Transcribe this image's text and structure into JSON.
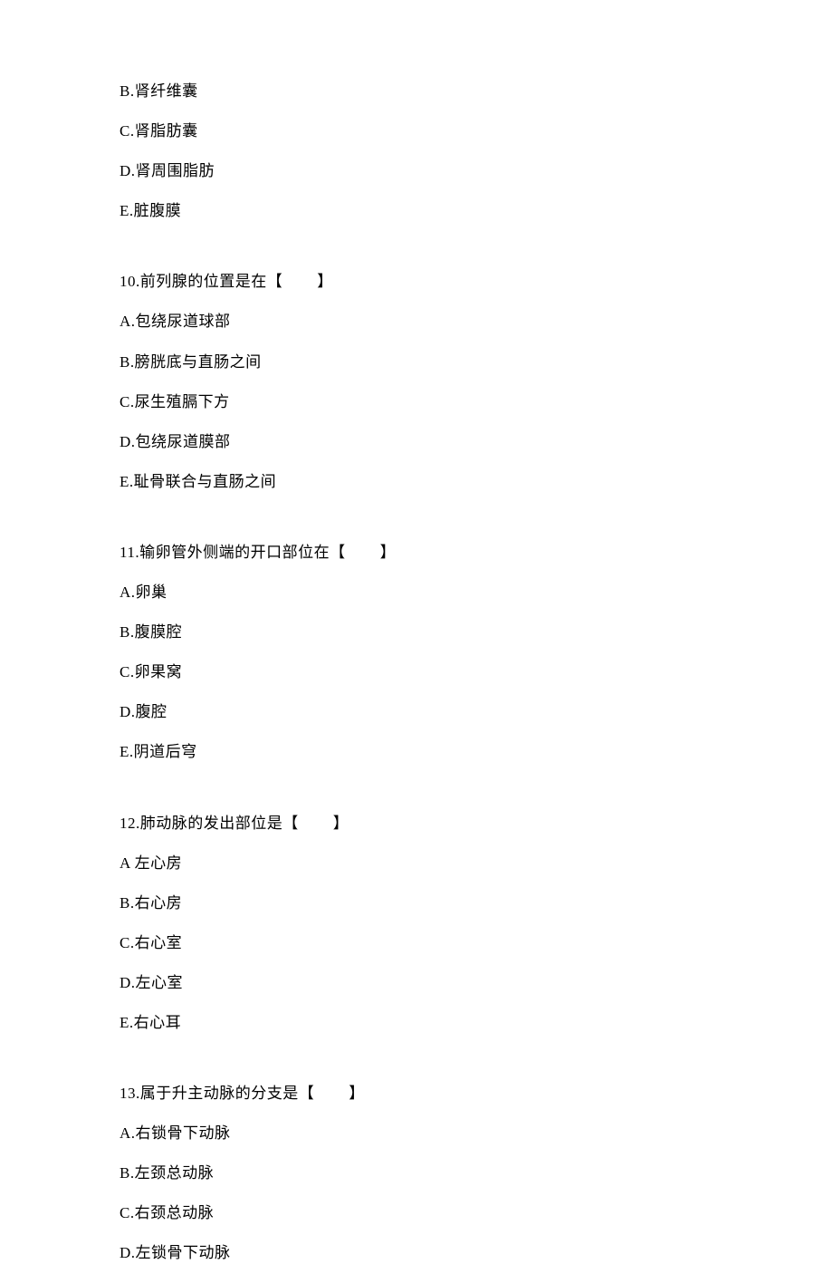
{
  "orphan_options": [
    "B.肾纤维囊",
    "C.肾脂肪囊",
    "D.肾周围脂肪",
    "E.脏腹膜"
  ],
  "questions": [
    {
      "stem": "10.前列腺的位置是在",
      "options": [
        "A.包绕尿道球部",
        "B.膀胱底与直肠之间",
        "C.尿生殖膈下方",
        "D.包绕尿道膜部",
        "E.耻骨联合与直肠之间"
      ]
    },
    {
      "stem": "11.输卵管外侧端的开口部位在",
      "options": [
        "A.卵巢",
        "B.腹膜腔",
        "C.卵果窝",
        "D.腹腔",
        "E.阴道后穹"
      ]
    },
    {
      "stem": "12.肺动脉的发出部位是",
      "options": [
        "A 左心房",
        "B.右心房",
        "C.右心室",
        "D.左心室",
        "E.右心耳"
      ]
    },
    {
      "stem": "13.属于升主动脉的分支是",
      "options": [
        "A.右锁骨下动脉",
        "B.左颈总动脉",
        "C.右颈总动脉",
        "D.左锁骨下动脉"
      ]
    }
  ],
  "bracket_open": "【",
  "bracket_close": "】"
}
